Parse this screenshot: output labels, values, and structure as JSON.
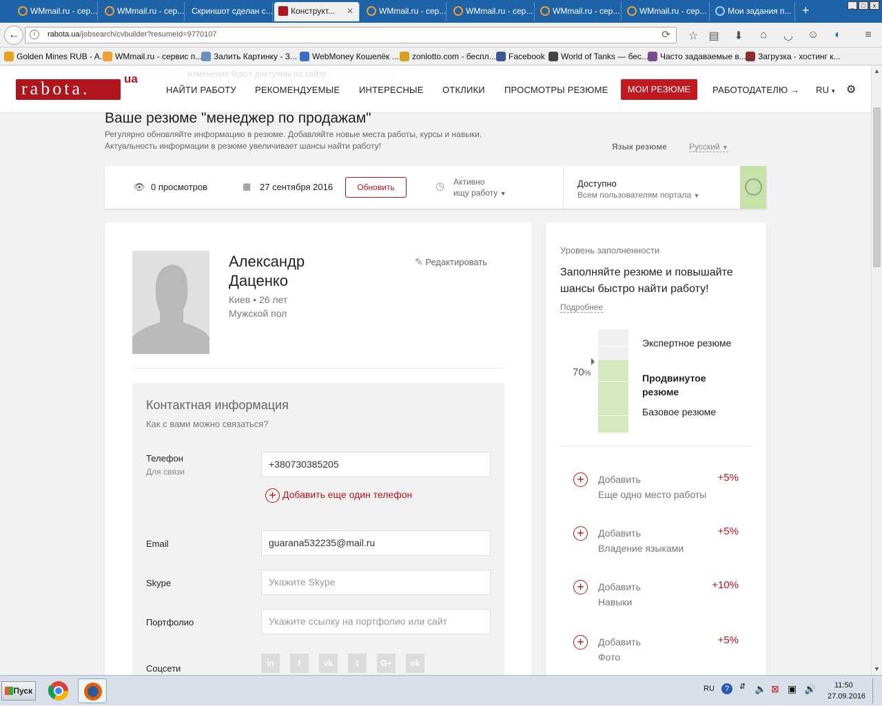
{
  "browser": {
    "tabs": [
      {
        "label": "WMmail.ru - сер..."
      },
      {
        "label": "WMmail.ru - сер..."
      },
      {
        "label": "Скриншот сделан с..."
      },
      {
        "label": "Конструкт..."
      },
      {
        "label": "WMmail.ru - сер..."
      },
      {
        "label": "WMmail.ru - сер..."
      },
      {
        "label": "WMmail.ru - сер..."
      },
      {
        "label": "WMmail.ru - сер..."
      },
      {
        "label": "Мои задания п..."
      }
    ],
    "new_tab": "+",
    "url_host": "rabota.ua",
    "url_path": "/jobsearch/cvbuilder?resumeId=9770107",
    "bookmarks": [
      {
        "label": "Golden Mines RUB - A...",
        "color": "#e8a020"
      },
      {
        "label": "WMmail.ru - сервис п...",
        "color": "#f0a030"
      },
      {
        "label": "Залить Картинку - З...",
        "color": "#6b8ebd"
      },
      {
        "label": "WebMoney Кошелёк ...",
        "color": "#3a6fc4"
      },
      {
        "label": "zonlotto.com - беспл...",
        "color": "#d8a020"
      },
      {
        "label": "Facebook",
        "color": "#3b5998"
      },
      {
        "label": "World of Tanks — бес...",
        "color": "#444444"
      },
      {
        "label": "Часто задаваемые в...",
        "color": "#7a4a8a"
      },
      {
        "label": "Загрузка - хостинг к...",
        "color": "#8a3030"
      }
    ]
  },
  "header": {
    "ghost_text": "изменения будут доступны на сайте",
    "logo": "rabota.",
    "logo_ua": "ua",
    "nav": [
      "НАЙТИ РАБОТУ",
      "РЕКОМЕНДУЕМЫЕ",
      "ИНТЕРЕСНЫЕ",
      "ОТКЛИКИ",
      "ПРОСМОТРЫ РЕЗЮМЕ"
    ],
    "nav_active": "МОИ РЕЗЮМЕ",
    "employer": "РАБОТОДАТЕЛЮ →",
    "lang": "RU",
    "brand_color": "#b0151d"
  },
  "resume": {
    "title": "Ваше резюме \"менеджер по продажам\"",
    "sub1": "Регулярно обновляйте информацию в резюме. Добавляйте новые места работы, курсы и навыки.",
    "sub2": "Актуальность информации в резюме увеличивает шансы найти работу!",
    "lang_label": "Язык резюме",
    "lang_value": "Русский"
  },
  "status": {
    "views": "0 просмотров",
    "date": "27 сентября 2016",
    "update_btn": "Обновить",
    "active1": "Активно",
    "active2": "ищу работу",
    "avail1": "Доступно",
    "avail2": "Всем пользователям портала"
  },
  "profile": {
    "name": "Александр Даценко",
    "city_age": "Киев • 26 лет",
    "gender": "Мужской пол",
    "edit": "Редактировать"
  },
  "contact": {
    "heading": "Контактная информация",
    "question": "Как с вами можно связаться?",
    "phone_label": "Телефон",
    "phone_sub": "Для связи",
    "phone_value": "+380730385205",
    "add_phone": "Добавить еще один телефон",
    "email_label": "Email",
    "email_value": "guarana532235@mail.ru",
    "skype_label": "Skype",
    "skype_placeholder": "Укажите Skype",
    "portfolio_label": "Портфолио",
    "portfolio_placeholder": "Укажите ссылку на портфолио или сайт",
    "social_label": "Соцсети",
    "socials": [
      "in",
      "f",
      "vk",
      "t",
      "G+",
      "ok"
    ]
  },
  "completeness": {
    "level_label": "Уровень заполненности",
    "headline": "Заполняйте резюме и повышайте шансы быстро найти работу!",
    "more": "Подробнее",
    "percent": "70",
    "percent_sign": "%",
    "fill_fraction": 0.7,
    "levels": [
      "Экспертное резюме",
      "Продвинутое резюме",
      "Базовое резюме"
    ],
    "fill_color": "#d5e8bd",
    "items": [
      {
        "action": "Добавить",
        "what": "Еще одно место работы",
        "bonus": "+5%"
      },
      {
        "action": "Добавить",
        "what": "Владение языками",
        "bonus": "+5%"
      },
      {
        "action": "Добавить",
        "what": "Навыки",
        "bonus": "+10%"
      },
      {
        "action": "Добавить",
        "what": "Фото",
        "bonus": "+5%"
      }
    ]
  },
  "taskbar": {
    "start": "Пуск",
    "lang": "RU",
    "time": "11:50",
    "date": "27.09.2016"
  }
}
